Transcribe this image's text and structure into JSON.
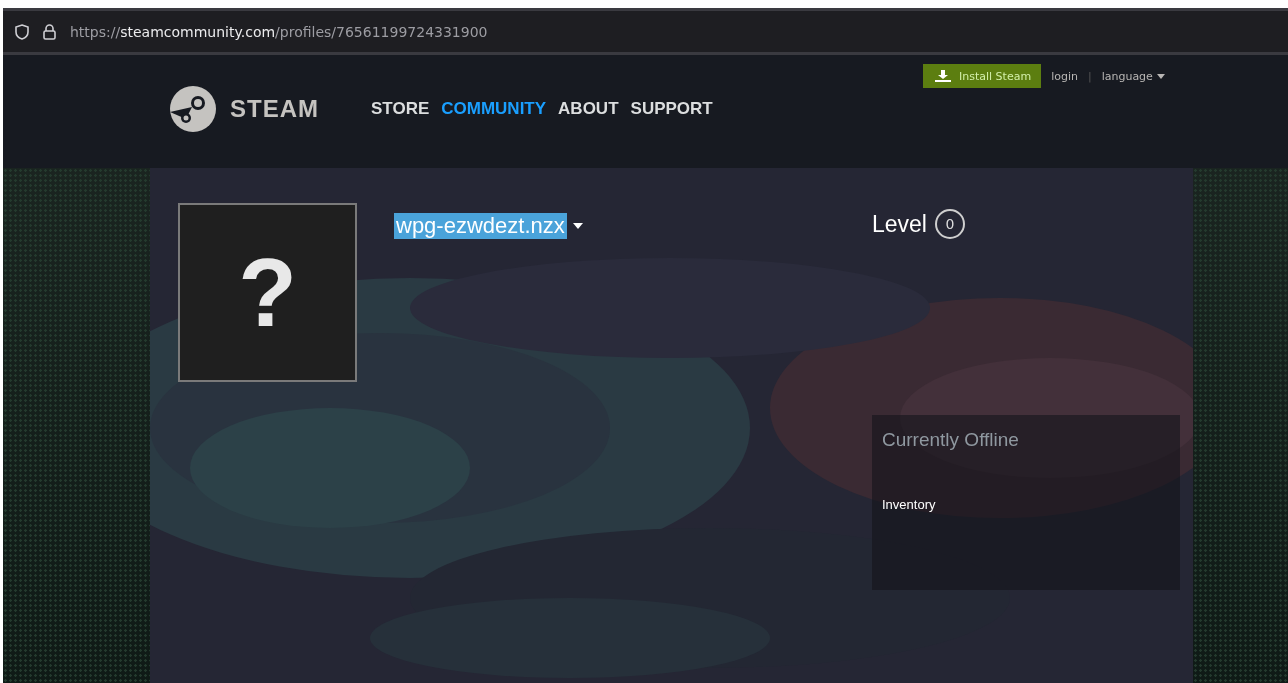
{
  "browser": {
    "url": {
      "scheme": "https://",
      "host": "steamcommunity.com",
      "path": "/profiles/76561199724331900"
    }
  },
  "header": {
    "logo": "STEAM",
    "nav": [
      {
        "label": "STORE",
        "selected": false
      },
      {
        "label": "COMMUNITY",
        "selected": true
      },
      {
        "label": "ABOUT",
        "selected": false
      },
      {
        "label": "SUPPORT",
        "selected": false
      }
    ],
    "install_button": "Install Steam",
    "login": "login",
    "separator": "|",
    "language": "language"
  },
  "profile": {
    "avatar": "?",
    "name": {
      "text": "wpg-ezwdezt.nzx",
      "selected": true
    },
    "level_label": "Level",
    "level": "0",
    "status": "Currently Offline",
    "links": [
      "Inventory"
    ]
  }
}
